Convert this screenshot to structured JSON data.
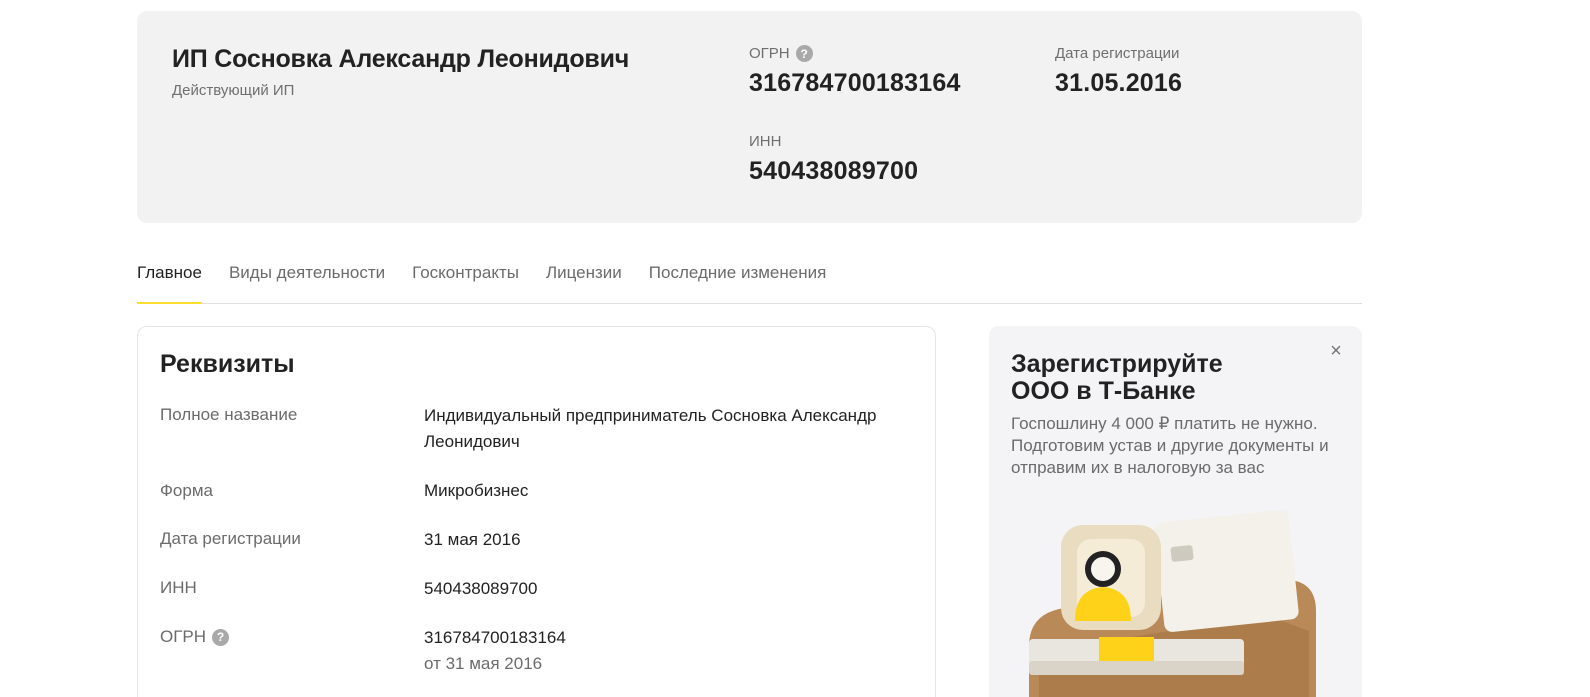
{
  "hero": {
    "company_name": "ИП Сосновка Александр Леонидович",
    "status": "Действующий ИП",
    "ogrn_label": "ОГРН",
    "ogrn_value": "316784700183164",
    "reg_date_label": "Дата регистрации",
    "reg_date_value": "31.05.2016",
    "inn_label": "ИНН",
    "inn_value": "540438089700"
  },
  "tabs": [
    {
      "label": "Главное",
      "active": true
    },
    {
      "label": "Виды деятельности",
      "active": false
    },
    {
      "label": "Госконтракты",
      "active": false
    },
    {
      "label": "Лицензии",
      "active": false
    },
    {
      "label": "Последние изменения",
      "active": false
    }
  ],
  "requisites": {
    "title": "Реквизиты",
    "rows": [
      {
        "label": "Полное название",
        "value": "Индивидуальный предприниматель Сосновка Александр Леонидович"
      },
      {
        "label": "Форма",
        "value": "Микробизнес"
      },
      {
        "label": "Дата регистрации",
        "value": "31 мая 2016"
      },
      {
        "label": "ИНН",
        "value": "540438089700"
      },
      {
        "label": "ОГРН",
        "value": "316784700183164",
        "sub": "от 31 мая 2016"
      }
    ]
  },
  "promo": {
    "title": "Зарегистрируйте ООО в Т-Банке",
    "text": "Госпошлину 4 000 ₽ платить не нужно. Подготовим устав и другие документы и отправим их в налоговую за вас",
    "close_icon": "×"
  },
  "icons": {
    "help": "?"
  },
  "colors": {
    "accent": "#ffdd2d",
    "hero_bg": "#f2f2f2",
    "promo_bg": "#f4f4f6"
  }
}
